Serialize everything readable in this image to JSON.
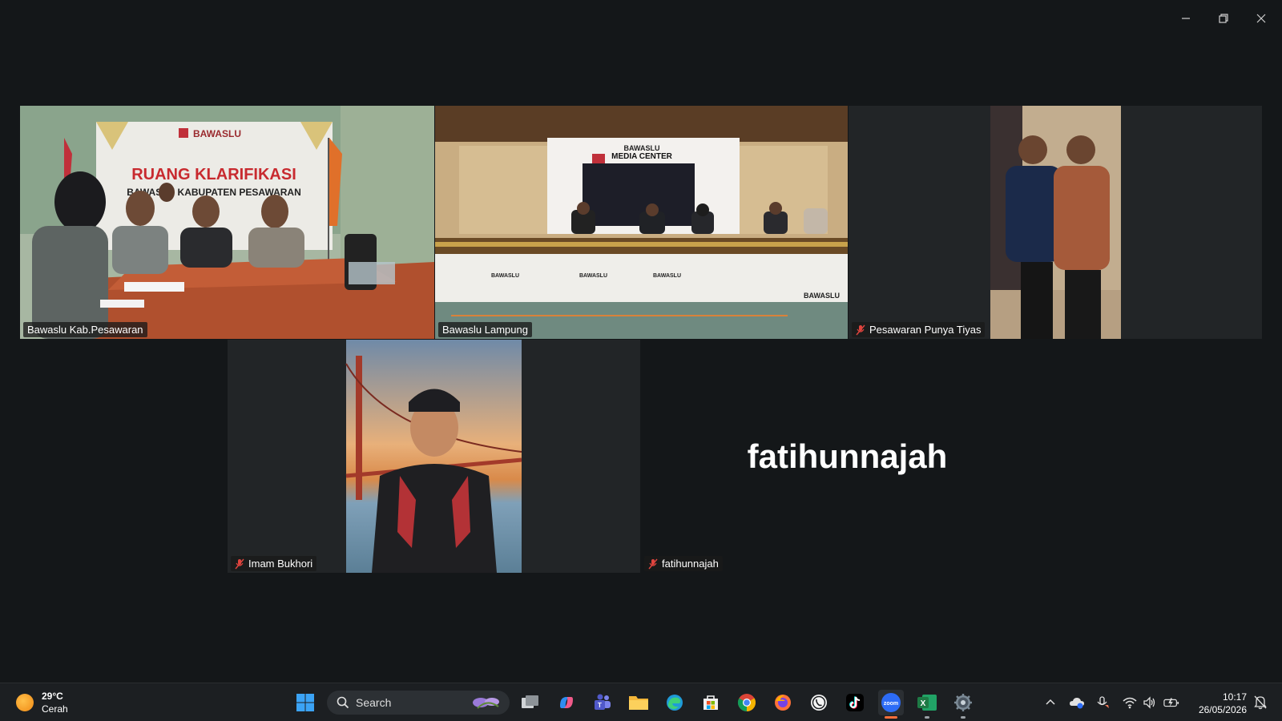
{
  "window": {
    "minimize_icon": "minimize-icon",
    "restore_icon": "restore-icon",
    "close_icon": "close-icon"
  },
  "participants": [
    {
      "name": "Bawaslu Kab.Pesawaran",
      "muted": false,
      "video": true,
      "active_speaker": true
    },
    {
      "name": "Bawaslu Lampung",
      "muted": false,
      "video": true,
      "active_speaker": false
    },
    {
      "name": "Pesawaran Punya Tiyas",
      "muted": true,
      "video": true,
      "active_speaker": false
    },
    {
      "name": "Imam Bukhori",
      "muted": true,
      "video": true,
      "active_speaker": false
    },
    {
      "name": "fatihunnajah",
      "muted": true,
      "video": false,
      "active_speaker": false,
      "display_name": "fatihunnajah"
    }
  ],
  "scene_text": {
    "banner_brand": "BAWASLU",
    "banner_title": "RUANG KLARIFIKASI",
    "banner_sub": "BAWASLU KABUPATEN PESAWARAN",
    "media_brand": "BAWASLU",
    "media_center": "MEDIA CENTER",
    "desk_brand": "BAWASLU"
  },
  "taskbar": {
    "weather": {
      "temp": "29°C",
      "condition": "Cerah",
      "icon": "sun-icon"
    },
    "search_placeholder": "Search",
    "apps": [
      {
        "name": "start",
        "icon": "windows-icon"
      },
      {
        "name": "task-view",
        "icon": "task-view-icon"
      },
      {
        "name": "copilot",
        "icon": "copilot-icon"
      },
      {
        "name": "teams",
        "icon": "teams-icon"
      },
      {
        "name": "file-explorer",
        "icon": "folder-icon"
      },
      {
        "name": "edge",
        "icon": "edge-icon"
      },
      {
        "name": "store",
        "icon": "store-icon"
      },
      {
        "name": "chrome",
        "icon": "chrome-icon"
      },
      {
        "name": "firefox",
        "icon": "firefox-icon"
      },
      {
        "name": "whatsapp",
        "icon": "whatsapp-icon"
      },
      {
        "name": "tiktok",
        "icon": "tiktok-icon"
      },
      {
        "name": "zoom",
        "icon": "zoom-icon",
        "label": "zoom",
        "active": true
      },
      {
        "name": "excel",
        "icon": "excel-icon",
        "label": "X"
      },
      {
        "name": "settings",
        "icon": "settings-gear-icon"
      }
    ],
    "tray_icons": [
      "chevron-up-icon",
      "onedrive-icon",
      "mic-icon",
      "wifi-icon",
      "volume-icon",
      "battery-icon",
      "notification-icon"
    ],
    "time": "10:17",
    "date": "26/05/2026"
  },
  "colors": {
    "background": "#141719",
    "active_speaker": "#2fd671",
    "zoom_blue": "#2d6cf6",
    "excel_green": "#1e7a45",
    "mute_red": "#e0443e"
  }
}
